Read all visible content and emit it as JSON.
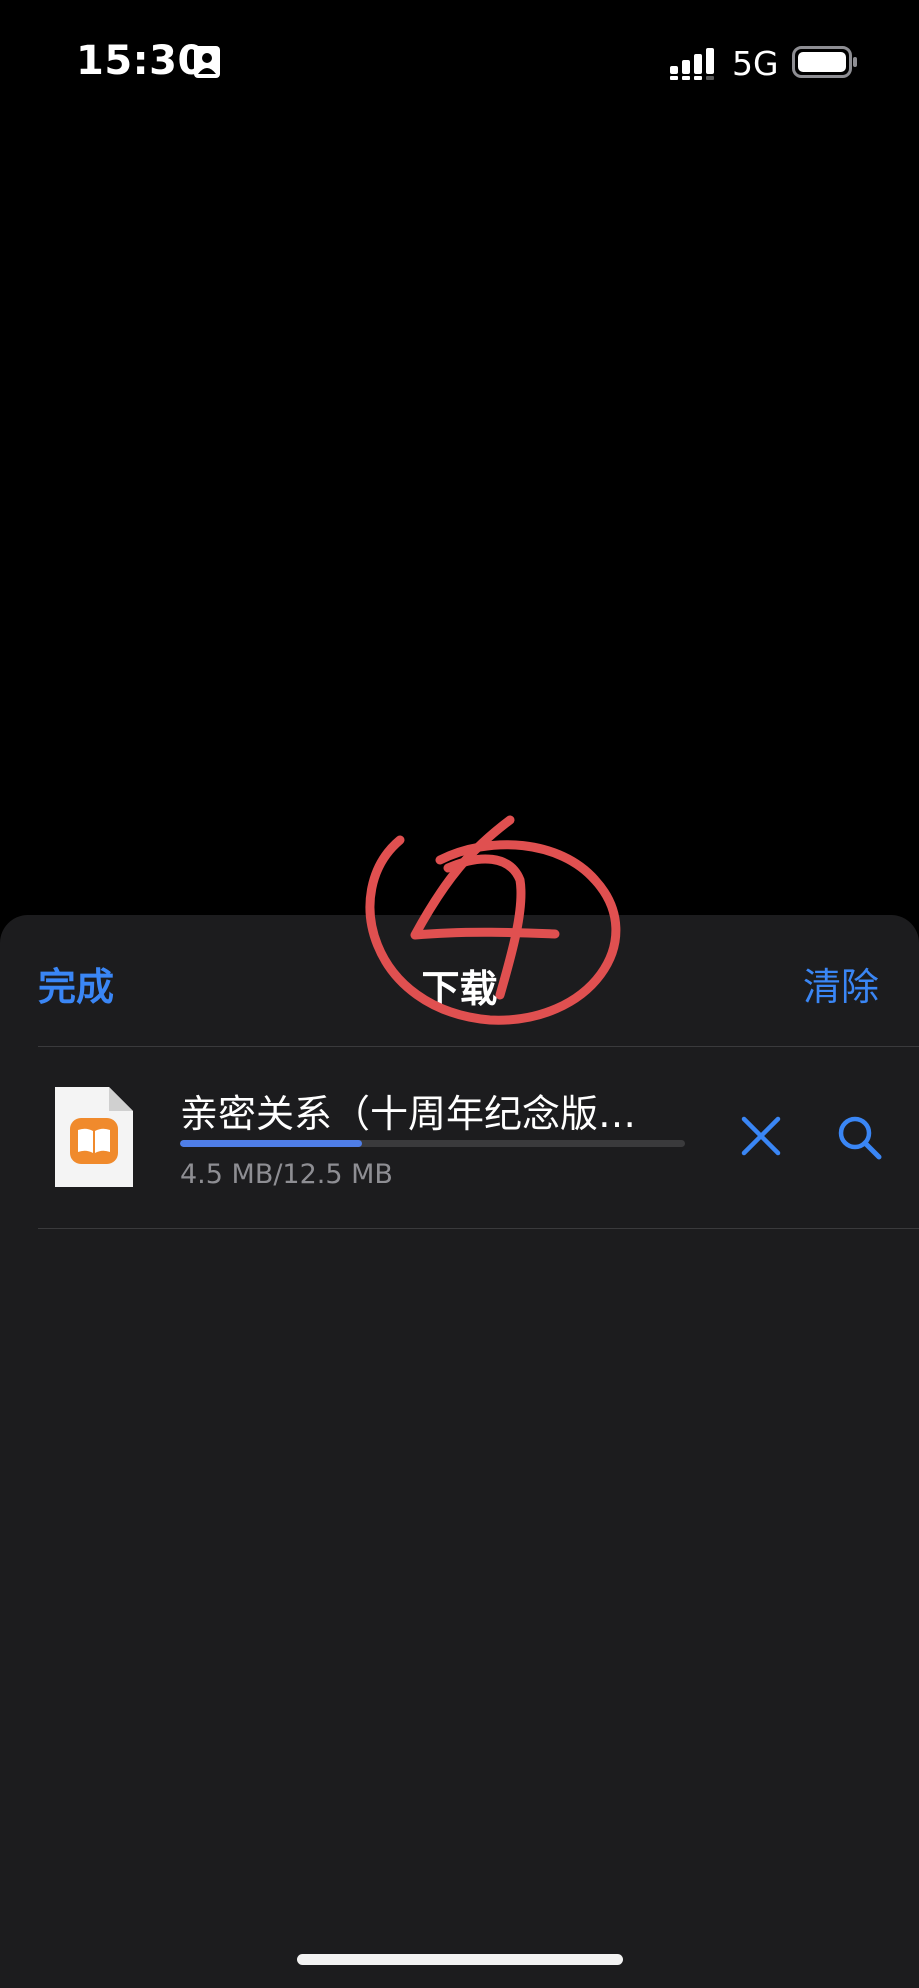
{
  "status_bar": {
    "time": "15:30",
    "network": "5G",
    "icons": [
      "contact-card-icon",
      "signal-bars-icon",
      "battery-icon"
    ]
  },
  "sheet": {
    "title": "下载",
    "done_label": "完成",
    "clear_label": "清除"
  },
  "download": {
    "file_name": "亲密关系（十周年纪念版…",
    "size_text": "4.5 MB/12.5 MB",
    "progress": 0.36,
    "file_icon": "books-file-icon",
    "actions": [
      "cancel-icon",
      "magnifier-icon"
    ]
  },
  "annotation": {
    "text": "4",
    "color": "#e05050"
  },
  "colors": {
    "accent": "#3a86f5",
    "sheet_background": "#1c1c1e",
    "progress_fill": "#4f7ee8"
  }
}
